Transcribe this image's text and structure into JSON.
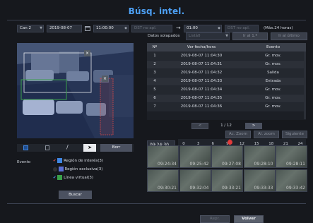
{
  "header": {
    "title": "Búsq. intel."
  },
  "filters": {
    "camera": "Can 2",
    "start_date": "2019-08-07",
    "start_time": "11:00:00",
    "dst_start": "DST no apl.",
    "arrow": "→",
    "end_time": "01:00",
    "dst_end": "DST no apl.",
    "max_hours": "(Máx.24 horas)",
    "overlap_label": "Datos solapados",
    "overlap_value": "Listá0",
    "goto_first": "Ir al 1.º",
    "goto_last": "Ir al último"
  },
  "results": {
    "headers": [
      "Nº",
      "Ver fecha/hora",
      "Evento"
    ],
    "rows": [
      {
        "no": "1",
        "datetime": "2019-08-07 11:04:30",
        "event": "Gr. mov."
      },
      {
        "no": "2",
        "datetime": "2019-08-07 11:04:31",
        "event": "Gr. mov."
      },
      {
        "no": "3",
        "datetime": "2019-08-07 11:04:32",
        "event": "Salida"
      },
      {
        "no": "4",
        "datetime": "2019-08-07 11:04:33",
        "event": "Entrada"
      },
      {
        "no": "5",
        "datetime": "2019-08-07 11:04:34",
        "event": "Gr. mov."
      },
      {
        "no": "6",
        "datetime": "2019-08-07 11:04:35",
        "event": "Gr. mov."
      },
      {
        "no": "7",
        "datetime": "2019-08-07 11:04:36",
        "event": "Gr. mov."
      }
    ],
    "page": "1 / 12",
    "prev": "<",
    "next": ">",
    "zoom_in": "Ac. Zoom",
    "zoom_out": "Al. zoom",
    "next_btn": "Siguiente"
  },
  "timeline": {
    "current_time": "09:24:30",
    "ticks": [
      "0",
      "3",
      "6",
      "9",
      "12",
      "15",
      "18",
      "21",
      "24"
    ],
    "cursor_hour": 9.4
  },
  "thumbnails": [
    "09:24:34",
    "09:25:42",
    "09:27:08",
    "09:28:10",
    "09:28:11",
    "09:30:21",
    "09:32:04",
    "09:33:21",
    "09:33:33",
    "09:33:42"
  ],
  "tools": {
    "delete": "Borr"
  },
  "event_panel": {
    "label": "Evento",
    "items": [
      {
        "label": "Región de interés(3)",
        "color": "#3f86e2",
        "checked": true
      },
      {
        "label": "Región exclusiva(3)",
        "color": "#5a6fd6",
        "checked": false
      },
      {
        "label": "Línea virtual(3)",
        "color": "#3aa04a",
        "checked": true
      }
    ],
    "search": "Buscar"
  },
  "footer": {
    "play": "Repr.",
    "back": "Volver"
  }
}
